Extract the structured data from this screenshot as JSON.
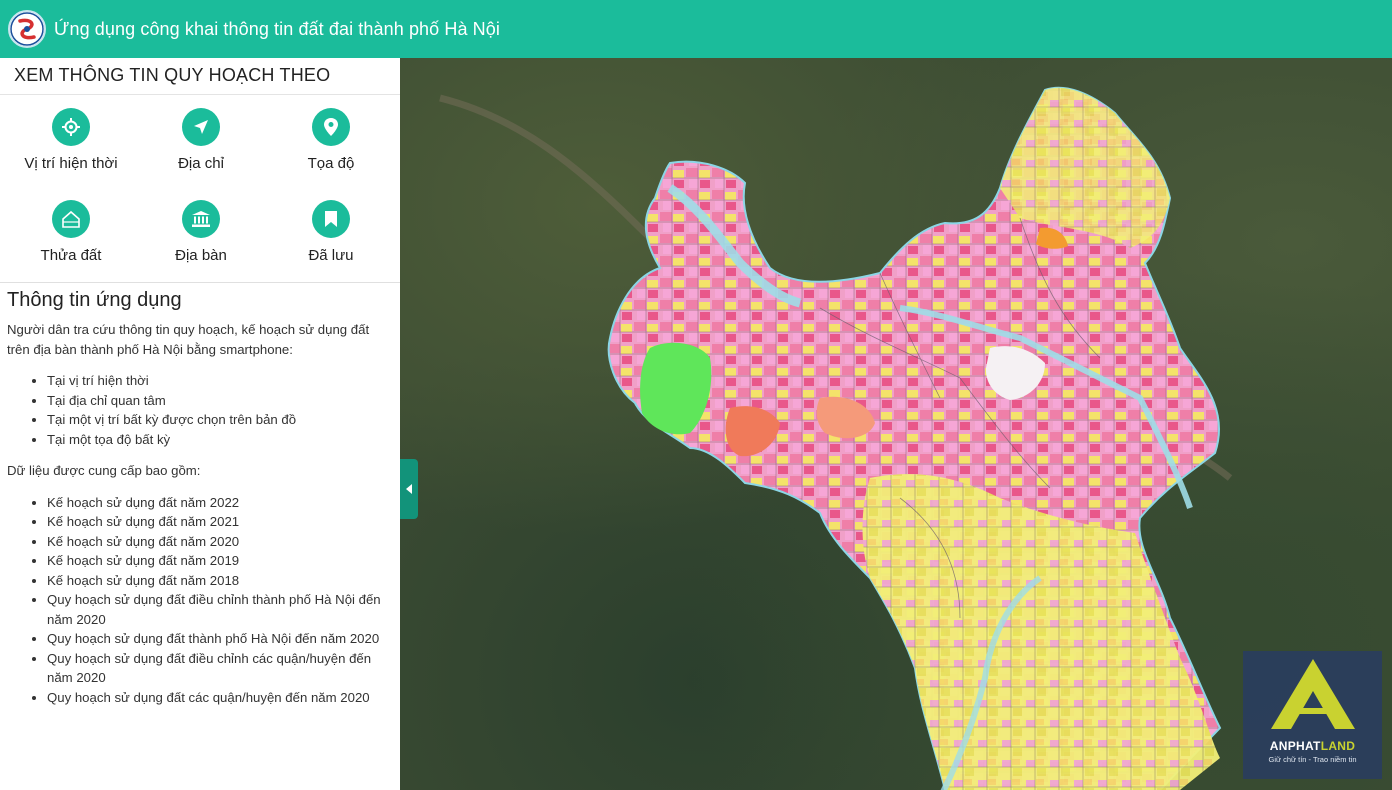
{
  "header": {
    "title": "Ứng dụng công khai thông tin đất đai thành phố Hà Nội",
    "logo_icon": "city-emblem-icon"
  },
  "sidebar": {
    "heading": "XEM THÔNG TIN QUY HOẠCH THEO",
    "options": [
      {
        "label": "Vị trí hiện thời",
        "icon": "crosshair-icon"
      },
      {
        "label": "Địa chỉ",
        "icon": "navigation-arrow-icon"
      },
      {
        "label": "Tọa độ",
        "icon": "map-pin-icon"
      },
      {
        "label": "Thửa đất",
        "icon": "house-icon"
      },
      {
        "label": "Địa bàn",
        "icon": "landmark-icon"
      },
      {
        "label": "Đã lưu",
        "icon": "bookmark-icon"
      }
    ]
  },
  "info": {
    "title": "Thông tin ứng dụng",
    "intro": "Người dân tra cứu thông tin quy hoạch, kế hoạch sử dụng đất trên địa bàn thành phố Hà Nội bằng smartphone:",
    "lookup_items": [
      "Tại vị trí hiện thời",
      "Tại địa chỉ quan tâm",
      "Tại một vị trí bất kỳ được chọn trên bản đồ",
      "Tại một tọa độ bất kỳ"
    ],
    "data_intro": "Dữ liệu được cung cấp bao gồm:",
    "data_items": [
      "Kế hoạch sử dụng đất năm 2022",
      "Kế hoạch sử dụng đất năm 2021",
      "Kế hoạch sử dụng đất năm 2020",
      "Kế hoạch sử dụng đất năm 2019",
      "Kế hoạch sử dụng đất năm 2018",
      "Quy hoạch sử dụng đất điều chỉnh thành phố Hà Nội đến năm 2020",
      "Quy hoạch sử dụng đất thành phố Hà Nội đến năm 2020",
      "Quy hoạch sử dụng đất điều chỉnh các quận/huyện đến năm 2020",
      "Quy hoạch sử dụng đất các quận/huyện đến năm 2020"
    ]
  },
  "map": {
    "collapse_icon": "chevron-left-icon"
  },
  "brand": {
    "name_part1": "ANPHAT",
    "name_part2": "LAND",
    "tagline": "Giữ chữ tín  -  Trao niềm tin"
  },
  "colors": {
    "primary": "#1bbc9b",
    "primary_dark": "#12937a",
    "brand_yellow": "#c9d230"
  }
}
